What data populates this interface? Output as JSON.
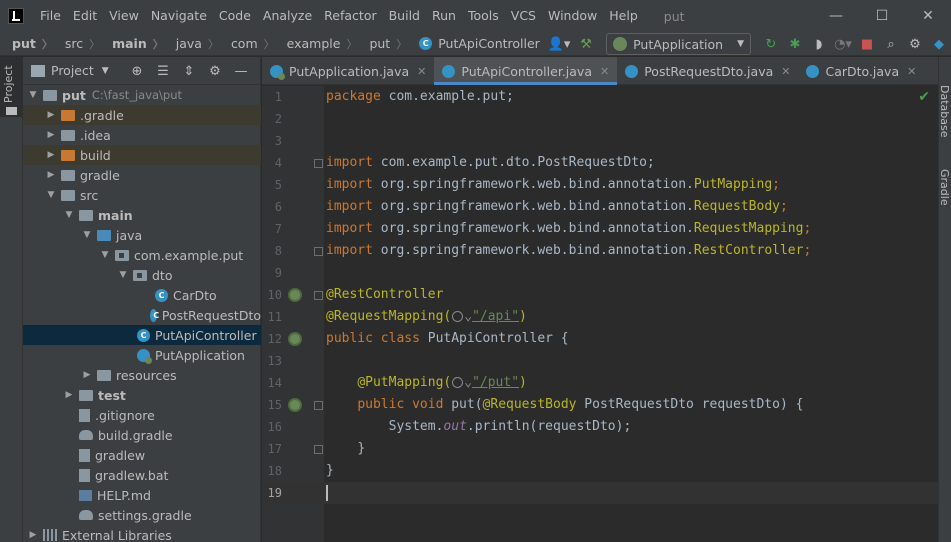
{
  "menubar": {
    "items": [
      "File",
      "Edit",
      "View",
      "Navigate",
      "Code",
      "Analyze",
      "Refactor",
      "Build",
      "Run",
      "Tools",
      "VCS",
      "Window",
      "Help"
    ],
    "project_title": "put",
    "minimize": "—",
    "maximize": "☐",
    "close": "✕"
  },
  "navbar": {
    "crumbs": [
      "put",
      "src",
      "main",
      "java",
      "com",
      "example",
      "put",
      "PutApiController"
    ],
    "run_config": "PutApplication"
  },
  "left_strip": {
    "project_tab": "Project"
  },
  "project_panel": {
    "title": "Project",
    "tree": [
      {
        "label": "put",
        "extra": "C:\\fast_java\\put"
      },
      {
        "label": ".gradle"
      },
      {
        "label": ".idea"
      },
      {
        "label": "build"
      },
      {
        "label": "gradle"
      },
      {
        "label": "src"
      },
      {
        "label": "main"
      },
      {
        "label": "java"
      },
      {
        "label": "com.example.put"
      },
      {
        "label": "dto"
      },
      {
        "label": "CarDto"
      },
      {
        "label": "PostRequestDto"
      },
      {
        "label": "PutApiController"
      },
      {
        "label": "PutApplication"
      },
      {
        "label": "resources"
      },
      {
        "label": "test"
      },
      {
        "label": ".gitignore"
      },
      {
        "label": "build.gradle"
      },
      {
        "label": "gradlew"
      },
      {
        "label": "gradlew.bat"
      },
      {
        "label": "HELP.md"
      },
      {
        "label": "settings.gradle"
      },
      {
        "label": "External Libraries"
      }
    ]
  },
  "tabs": [
    {
      "label": "PutApplication.java"
    },
    {
      "label": "PutApiController.java"
    },
    {
      "label": "PostRequestDto.java"
    },
    {
      "label": "CarDto.java"
    }
  ],
  "right_strip": {
    "database": "Database",
    "gradle": "Gradle"
  },
  "editor": {
    "line_numbers": [
      "1",
      "2",
      "3",
      "4",
      "5",
      "6",
      "7",
      "8",
      "9",
      "10",
      "11",
      "12",
      "13",
      "14",
      "15",
      "16",
      "17",
      "18",
      "19"
    ],
    "l1a": "package ",
    "l1b": "com.example.put;",
    "l4a": "import ",
    "l4b": "com.example.put.dto.PostRequestDto;",
    "l5a": "import ",
    "l5b": "org.springframework.web.bind.annotation.",
    "l5c": "PutMapping",
    "l5d": ";",
    "l6a": "import ",
    "l6b": "org.springframework.web.bind.annotation.",
    "l6c": "RequestBody",
    "l6d": ";",
    "l7a": "import ",
    "l7b": "org.springframework.web.bind.annotation.",
    "l7c": "RequestMapping",
    "l7d": ";",
    "l8a": "import ",
    "l8b": "org.springframework.web.bind.annotation.",
    "l8c": "RestController",
    "l8d": ";",
    "l10a": "@RestController",
    "l11a": "@RequestMapping(",
    "l11b": "\"/api\"",
    "l11c": ")",
    "l11caret": "⌄",
    "l12a": "public class ",
    "l12b": "PutApiController {",
    "l14a": "@PutMapping(",
    "l14b": "\"/put\"",
    "l14c": ")",
    "l14caret": "⌄",
    "l15a": "public void ",
    "l15b": "put(",
    "l15c": "@RequestBody",
    "l15d": " PostRequestDto requestDto) {",
    "l16a": "System.",
    "l16b": "out",
    "l16c": ".println(requestDto);",
    "l17a": "}",
    "l18a": "}"
  }
}
